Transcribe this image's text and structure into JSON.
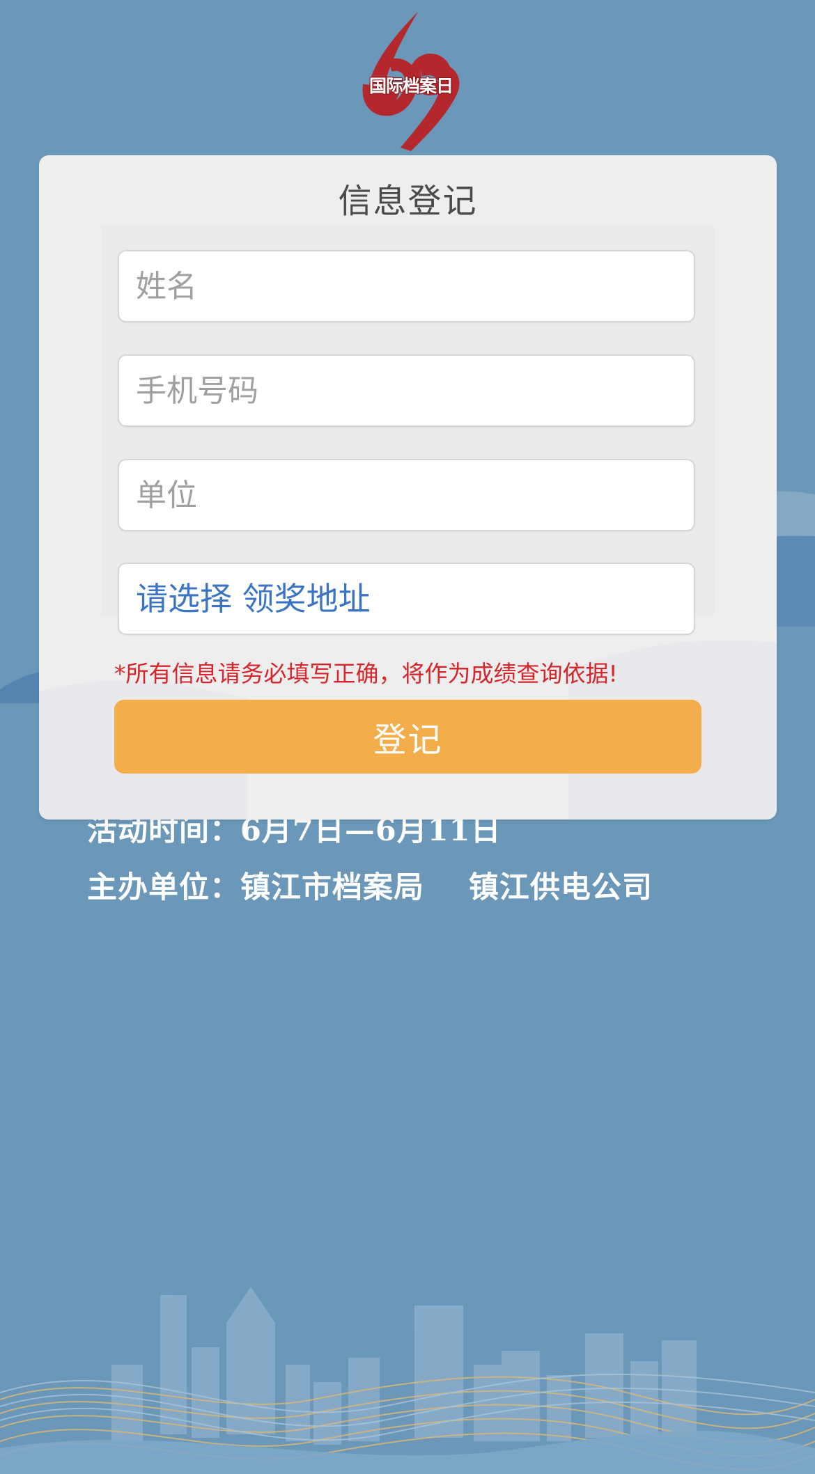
{
  "logo": {
    "numeral": "69",
    "text": "国际档案日"
  },
  "form": {
    "title": "信息登记",
    "name_placeholder": "姓名",
    "phone_placeholder": "手机号码",
    "unit_placeholder": "单位",
    "address_select_label": "请选择 领奖地址",
    "notice": "*所有信息请务必填写正确，将作为成绩查询依据!",
    "submit_label": "登记"
  },
  "event": {
    "time_line": "活动时间：6月7日—6月11日",
    "organizer_line": "主办单位：镇江市档案局    镇江供电公司"
  },
  "colors": {
    "background": "#6b97b9",
    "card": "#eeeeef",
    "accent_orange": "#f4ad4b",
    "link_blue": "#3a74c4",
    "notice_red": "#d6262b",
    "logo_red": "#b3272d"
  }
}
